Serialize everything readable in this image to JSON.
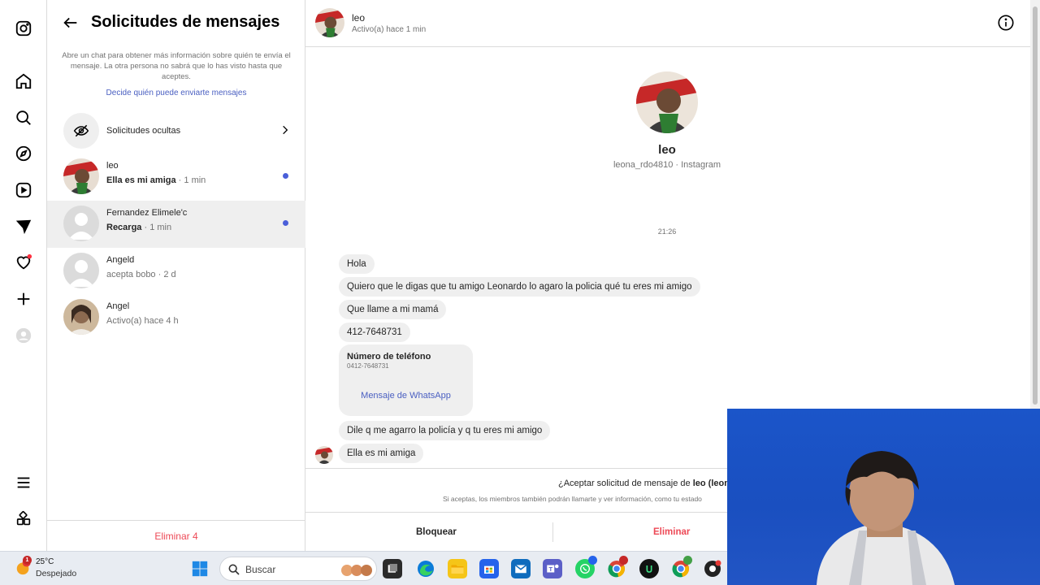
{
  "panel": {
    "title": "Solicitudes de mensajes",
    "info": "Abre un chat para obtener más información sobre quién te envía el mensaje. La otra persona no sabrá que lo has visto hasta que aceptes.",
    "decide_link": "Decide quién puede enviarte mensajes",
    "hidden_requests": "Solicitudes ocultas",
    "delete_all": "Eliminar 4",
    "requests": [
      {
        "name": "leo",
        "preview": "Ella es mi amiga",
        "time": "· 1 min",
        "unread": true
      },
      {
        "name": "Fernandez Elimele'c",
        "preview": "Recarga",
        "time": "· 1 min",
        "unread": true
      },
      {
        "name": "Angeld",
        "preview": "acepta bobo · 2 d",
        "unread": false
      },
      {
        "name": "Angel",
        "preview": "Activo(a) hace 4 h",
        "unread": false
      }
    ]
  },
  "chat": {
    "header_name": "leo",
    "header_status": "Activo(a) hace 1 min",
    "profile_name": "leo",
    "profile_sub": "leona_rdo4810 · Instagram",
    "timestamp": "21:26",
    "messages": [
      "Hola",
      "Quiero que le digas que tu amigo Leonardo lo agaro la policia qué tu eres mi amigo",
      "Que llame a mi mamá",
      "412-7648731",
      "Dile q me agarro la policía y q tu eres mi amigo",
      "Ella es mi amiga"
    ],
    "card": {
      "title": "Número de teléfono",
      "number": "0412-7648731",
      "link": "Mensaje de WhatsApp"
    },
    "accept_prefix": "¿Aceptar solicitud de mensaje de ",
    "accept_name": "leo (leon",
    "accept_note": "Si aceptas, los miembros también podrán llamarte y ver información, como tu estado",
    "block": "Bloquear",
    "delete": "Eliminar"
  },
  "taskbar": {
    "temp": "25°C",
    "weather": "Despejado",
    "weather_badge": "1",
    "search": "Buscar"
  },
  "colors": {
    "accent_link": "#4a5fc1",
    "unread_dot": "#4a5fd9",
    "danger": "#ed4956",
    "bubble": "#efefef"
  }
}
